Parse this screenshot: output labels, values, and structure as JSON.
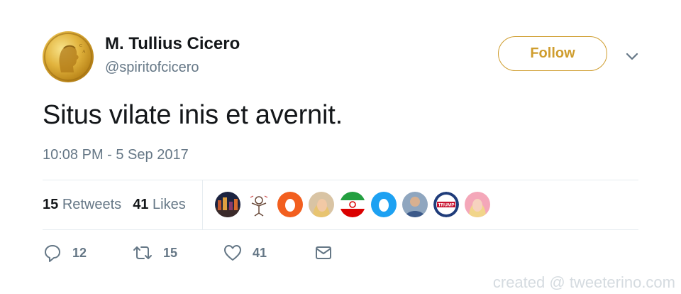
{
  "user": {
    "name": "M. Tullius Cicero",
    "handle": "@spiritofcicero",
    "avatar_icon": "gold-coin-portrait-icon"
  },
  "follow_button": {
    "label": "Follow",
    "color": "#cf9d2e"
  },
  "tweet": {
    "text": "Situs vilate inis et avernit.",
    "timestamp": "10:08 PM - 5 Sep 2017"
  },
  "stats": {
    "retweets_count": "15",
    "retweets_label": "Retweets",
    "likes_count": "41",
    "likes_label": "Likes"
  },
  "likers": [
    {
      "icon": "city-night-avatar"
    },
    {
      "icon": "sketch-figure-avatar"
    },
    {
      "icon": "orange-egg-avatar"
    },
    {
      "icon": "blonde-woman-avatar"
    },
    {
      "icon": "iran-flag-avatar"
    },
    {
      "icon": "blue-egg-avatar"
    },
    {
      "icon": "man-photo-avatar"
    },
    {
      "icon": "trump-badge-avatar",
      "text": "TRUMP"
    },
    {
      "icon": "pink-woman-avatar"
    }
  ],
  "actions": {
    "reply_count": "12",
    "retweet_count": "15",
    "like_count": "41"
  },
  "watermark": "created @ tweeterino.com",
  "colors": {
    "text": "#14171a",
    "secondary": "#657786",
    "divider": "#e6ecf0",
    "accent": "#cf9d2e"
  }
}
